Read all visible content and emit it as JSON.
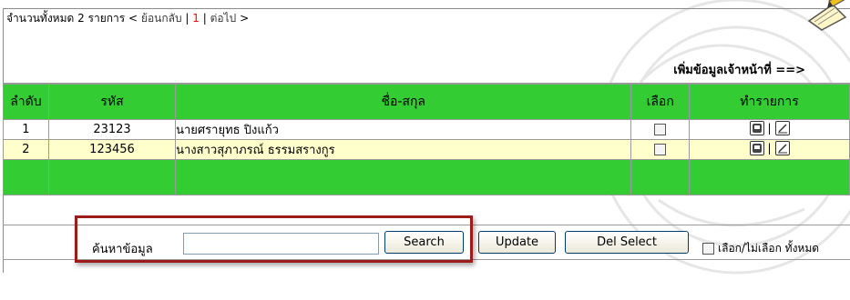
{
  "paging": {
    "total_text": "จำนวนทั้งหมด 2 รายการ < ",
    "prev": "ย้อนกลับ",
    "sep1": " | ",
    "current": "1",
    "sep2": " | ",
    "next": "ต่อไป",
    "tail": " >"
  },
  "add_link": "เพิ่มข้อมูลเจ้าหน้าที่ ==>",
  "table": {
    "headers": [
      "ลำดับ",
      "รหัส",
      "ชื่อ-สกุล",
      "เลือก",
      "ทำรายการ"
    ],
    "rows": [
      {
        "index": "1",
        "code": "23123",
        "name": "นายศรายุทธ ปิงแก้ว",
        "checked": false
      },
      {
        "index": "2",
        "code": "123456",
        "name": "นางสาวสุภาภรณ์ ธรรมสรางกูร",
        "checked": false
      }
    ],
    "action_sep": "|"
  },
  "search": {
    "label": "ค้นหาข้อมูล",
    "value": "",
    "search_button": "Search",
    "update_button": "Update",
    "del_select_button": "Del Select",
    "select_all_label": "เลือก/ไม่เลือก ทั้งหมด"
  },
  "colors": {
    "header_green": "#33cc33",
    "alt_row": "#ffffcc",
    "current_page": "#ff0000",
    "highlight_border": "#9c1c1c"
  }
}
